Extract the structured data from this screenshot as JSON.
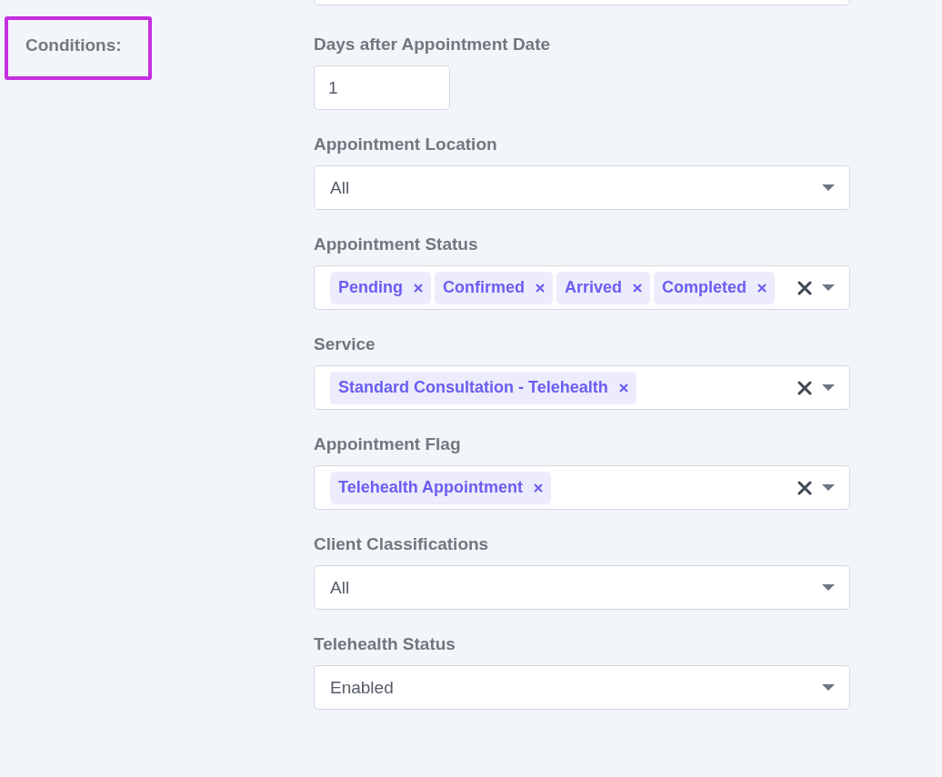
{
  "section_label": "Conditions:",
  "fields": [
    {
      "kind": "text",
      "label": "Days after Appointment Date",
      "value": "1"
    },
    {
      "kind": "select",
      "label": "Appointment Location",
      "value": "All"
    },
    {
      "kind": "multiselect",
      "label": "Appointment Status",
      "tags": [
        "Pending",
        "Confirmed",
        "Arrived",
        "Completed"
      ]
    },
    {
      "kind": "multiselect",
      "label": "Service",
      "tags": [
        "Standard Consultation - Telehealth"
      ]
    },
    {
      "kind": "multiselect",
      "label": "Appointment Flag",
      "tags": [
        "Telehealth Appointment"
      ]
    },
    {
      "kind": "select",
      "label": "Client Classifications",
      "value": "All"
    },
    {
      "kind": "select",
      "label": "Telehealth Status",
      "value": "Enabled"
    }
  ]
}
